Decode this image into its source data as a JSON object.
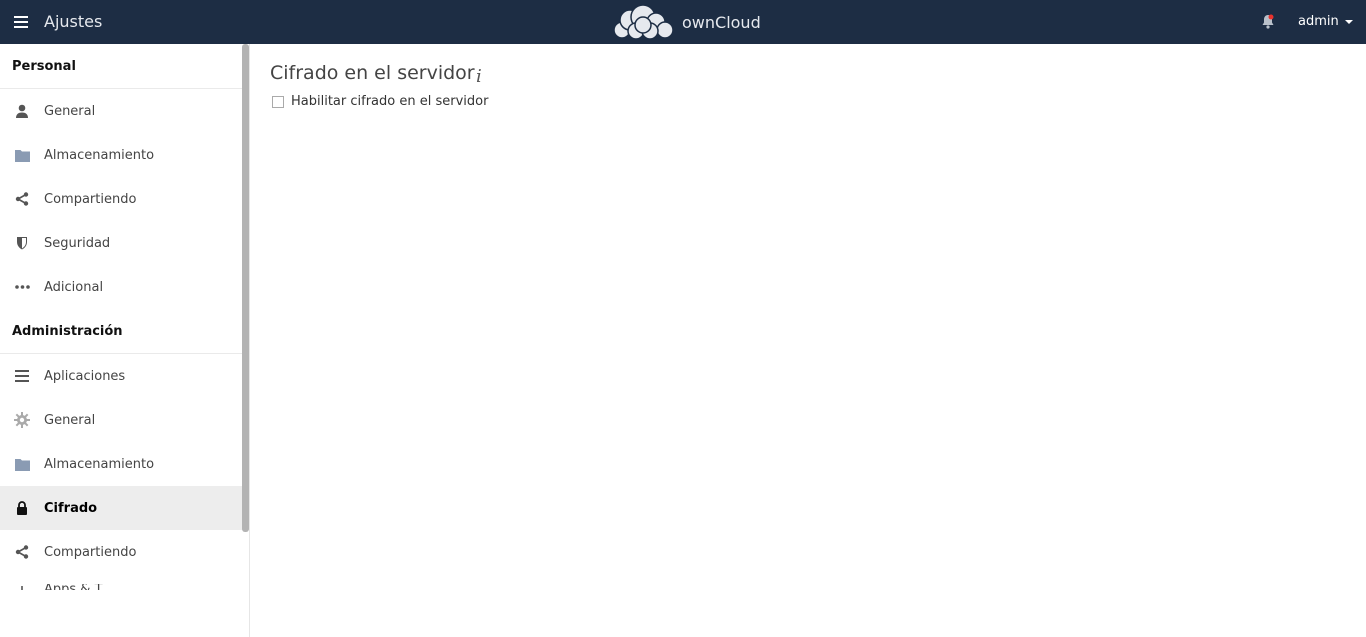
{
  "header": {
    "app_title": "Ajustes",
    "logo_text": "ownCloud",
    "user": "admin",
    "colors": {
      "background": "#1d2d44",
      "text": "#ffffff"
    }
  },
  "sidebar": {
    "personal_title": "Personal",
    "personal_items": [
      {
        "label": "General",
        "icon": "user-icon"
      },
      {
        "label": "Almacenamiento",
        "icon": "folder-icon"
      },
      {
        "label": "Compartiendo",
        "icon": "share-icon"
      },
      {
        "label": "Seguridad",
        "icon": "shield-icon"
      },
      {
        "label": "Adicional",
        "icon": "more-icon"
      }
    ],
    "admin_title": "Administración",
    "admin_items": [
      {
        "label": "Aplicaciones",
        "icon": "list-icon"
      },
      {
        "label": "General",
        "icon": "gear-icon"
      },
      {
        "label": "Almacenamiento",
        "icon": "folder-icon"
      },
      {
        "label": "Cifrado",
        "icon": "lock-icon",
        "active": true
      },
      {
        "label": "Compartiendo",
        "icon": "share-icon"
      },
      {
        "label": "Apps & T...",
        "icon": "partial-icon"
      }
    ]
  },
  "main": {
    "title": "Cifrado en el servidor",
    "info_symbol": "i",
    "checkbox_label": "Habilitar cifrado en el servidor",
    "checkbox_checked": false
  }
}
